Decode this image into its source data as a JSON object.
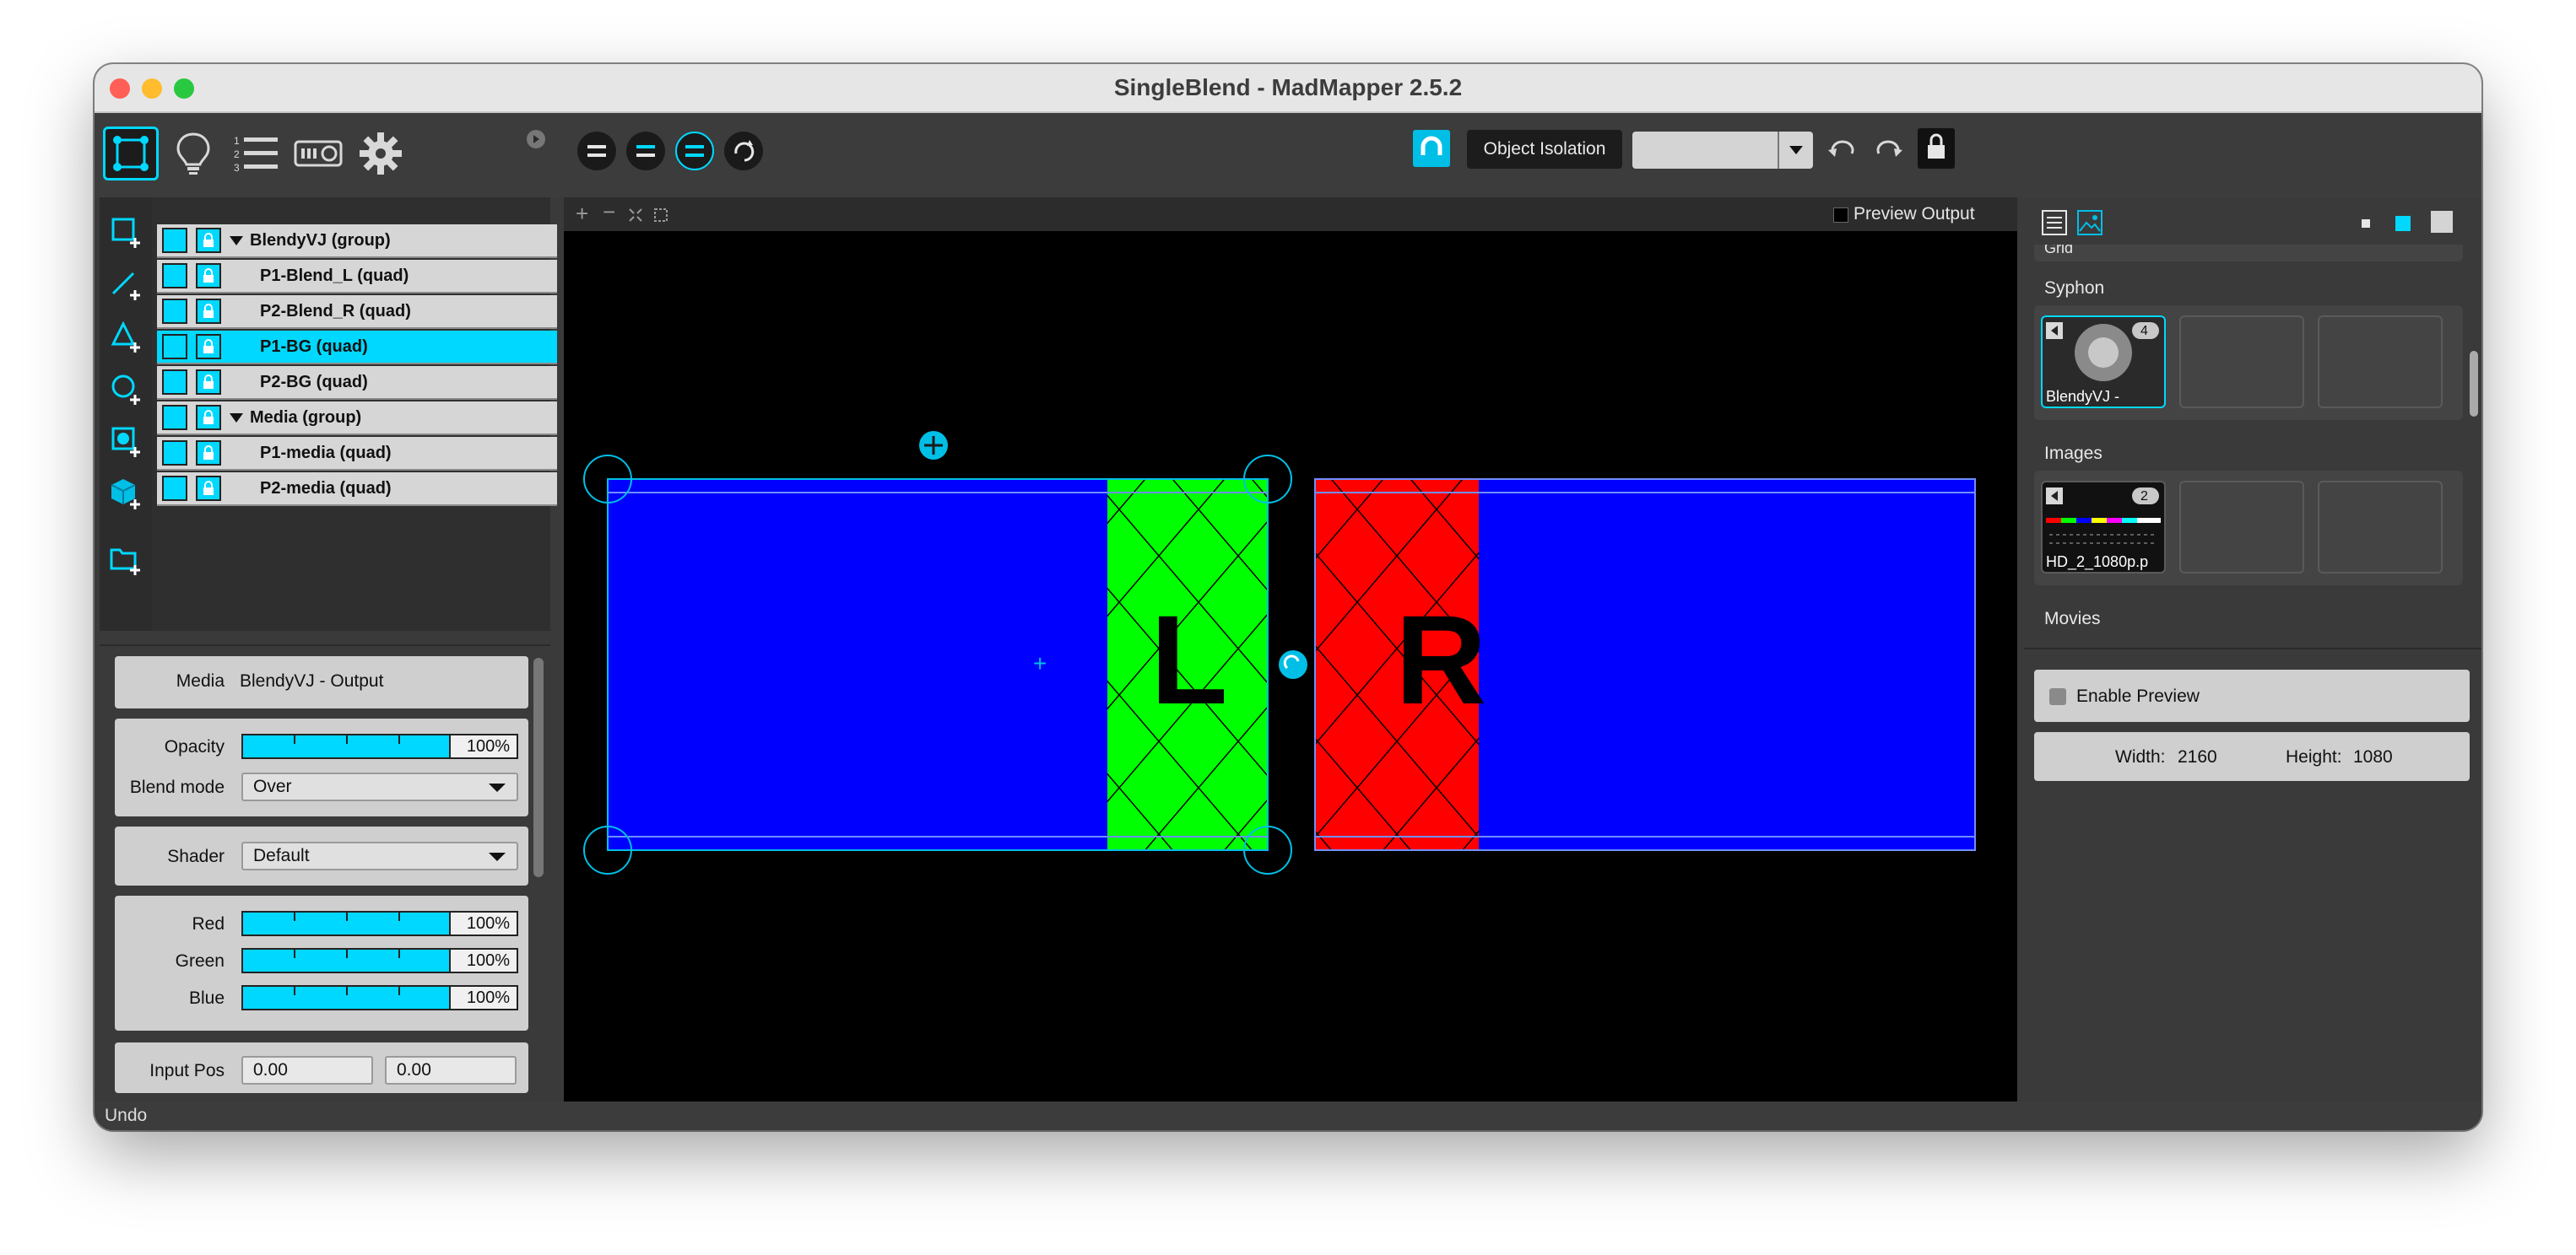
{
  "window": {
    "title": "SingleBlend - MadMapper 2.5.2"
  },
  "toolbar": {
    "object_isolation_label": "Object Isolation",
    "isolation_select_value": ""
  },
  "layers": {
    "items": [
      {
        "label": "BlendyVJ (group)",
        "group": true,
        "selected": false
      },
      {
        "label": "P1-Blend_L (quad)",
        "group": false,
        "selected": false
      },
      {
        "label": "P2-Blend_R (quad)",
        "group": false,
        "selected": false
      },
      {
        "label": "P1-BG (quad)",
        "group": false,
        "selected": true
      },
      {
        "label": "P2-BG (quad)",
        "group": false,
        "selected": false
      },
      {
        "label": "Media (group)",
        "group": true,
        "selected": false
      },
      {
        "label": "P1-media (quad)",
        "group": false,
        "selected": false
      },
      {
        "label": "P2-media (quad)",
        "group": false,
        "selected": false
      }
    ]
  },
  "properties": {
    "media_label": "Media",
    "media_value": "BlendyVJ - Output",
    "opacity_label": "Opacity",
    "opacity_value": "100%",
    "blend_mode_label": "Blend mode",
    "blend_mode_value": "Over",
    "shader_label": "Shader",
    "shader_value": "Default",
    "red_label": "Red",
    "red_value": "100%",
    "green_label": "Green",
    "green_value": "100%",
    "blue_label": "Blue",
    "blue_value": "100%",
    "input_pos_label": "Input Pos",
    "input_pos_x": "0.00",
    "input_pos_y": "0.00"
  },
  "canvas": {
    "preview_output_label": "Preview Output",
    "left_letter": "L",
    "right_letter": "R",
    "colors": {
      "blue": "#0000ff",
      "green": "#00ff00",
      "red": "#ff0000",
      "handle": "#00bfe6"
    }
  },
  "library": {
    "top_label": "Grid",
    "syphon_label": "Syphon",
    "syphon_item_label": "BlendyVJ -",
    "syphon_count": "4",
    "images_label": "Images",
    "images_item_label": "HD_2_1080p.p",
    "images_count": "2",
    "movies_label": "Movies"
  },
  "preview": {
    "enable_label": "Enable Preview",
    "width_label": "Width:",
    "width_value": "2160",
    "height_label": "Height:",
    "height_value": "1080"
  },
  "status": {
    "text": "Undo"
  },
  "accent_color": "#00d8ff"
}
